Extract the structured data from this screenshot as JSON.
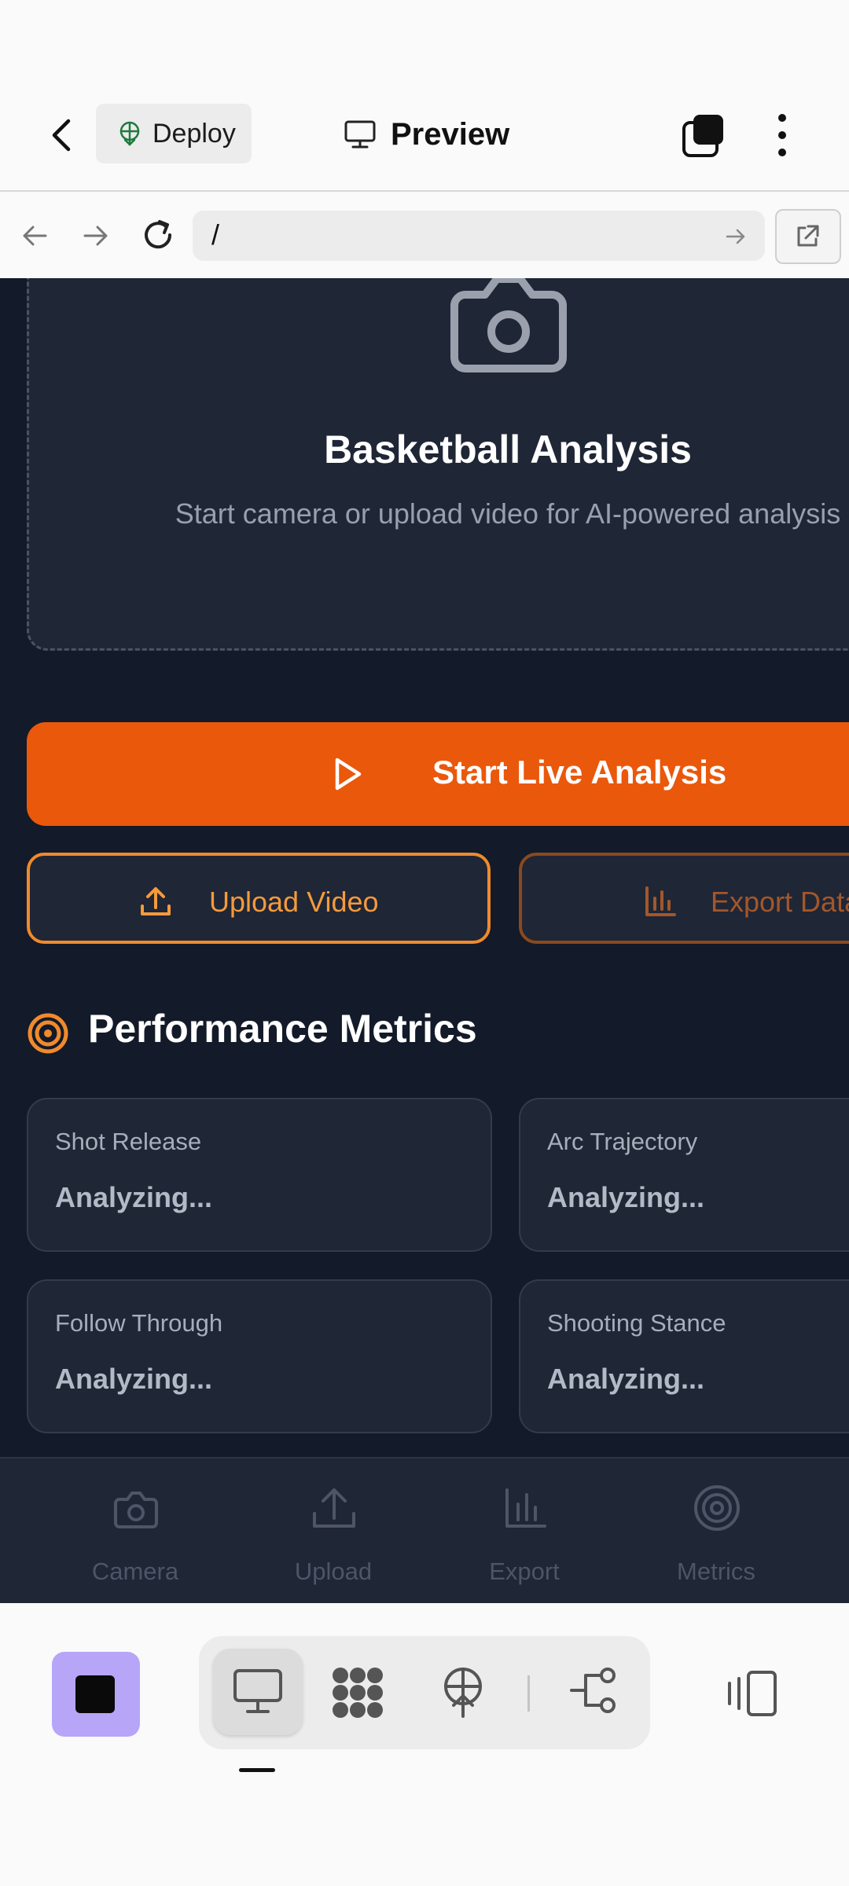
{
  "header": {
    "deploy_label": "Deploy",
    "preview_label": "Preview"
  },
  "urlbar": {
    "url": "/"
  },
  "hero": {
    "title": "Basketball Analysis",
    "subtitle": "Start camera or upload video for AI-powered analysis"
  },
  "actions": {
    "start_label": "Start Live Analysis",
    "upload_label": "Upload Video",
    "export_label": "Export Data"
  },
  "metrics": {
    "title": "Performance Metrics",
    "cards": [
      {
        "label": "Shot Release",
        "value": "Analyzing..."
      },
      {
        "label": "Arc Trajectory",
        "value": "Analyzing..."
      },
      {
        "label": "Follow Through",
        "value": "Analyzing..."
      },
      {
        "label": "Shooting Stance",
        "value": "Analyzing..."
      }
    ]
  },
  "bottom_nav": {
    "items": [
      {
        "label": "Camera",
        "icon": "camera-icon"
      },
      {
        "label": "Upload",
        "icon": "upload-icon"
      },
      {
        "label": "Export",
        "icon": "bar-chart-icon"
      },
      {
        "label": "Metrics",
        "icon": "target-icon"
      }
    ]
  },
  "colors": {
    "accent": "#ea580c",
    "accent_outline": "#f08a2c",
    "app_bg": "#131a29",
    "card_bg": "#1f2636",
    "stop_button": "#b7a5f8"
  }
}
